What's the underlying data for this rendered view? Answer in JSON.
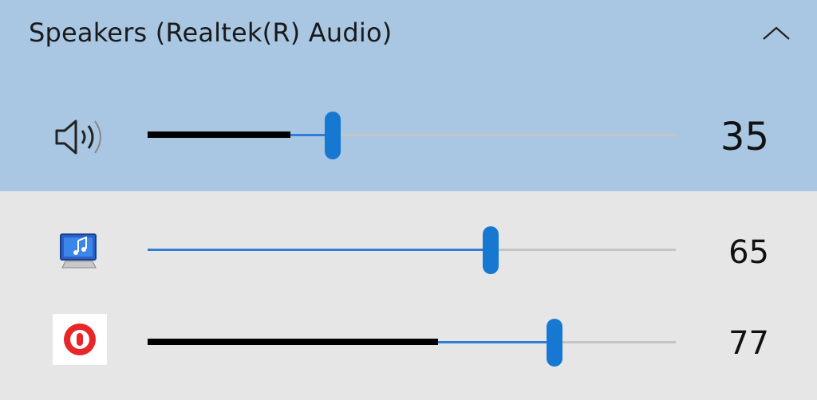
{
  "device": {
    "name": "Speakers (Realtek(R) Audio)",
    "collapse_icon": "chevron-up-icon"
  },
  "master": {
    "icon": "speaker-volume-icon",
    "volume": 35,
    "volume_label": "35",
    "peak_level": 27
  },
  "apps": [
    {
      "icon": "system-sounds-icon",
      "volume": 65,
      "volume_label": "65",
      "peak_level": 0
    },
    {
      "icon": "app-record-icon",
      "volume": 77,
      "volume_label": "77",
      "peak_level": 55
    }
  ],
  "colors": {
    "header_bg": "#a9c7e2",
    "panel_bg": "#e6e6e6",
    "accent": "#1778d2",
    "track": "#c4c4c4"
  }
}
